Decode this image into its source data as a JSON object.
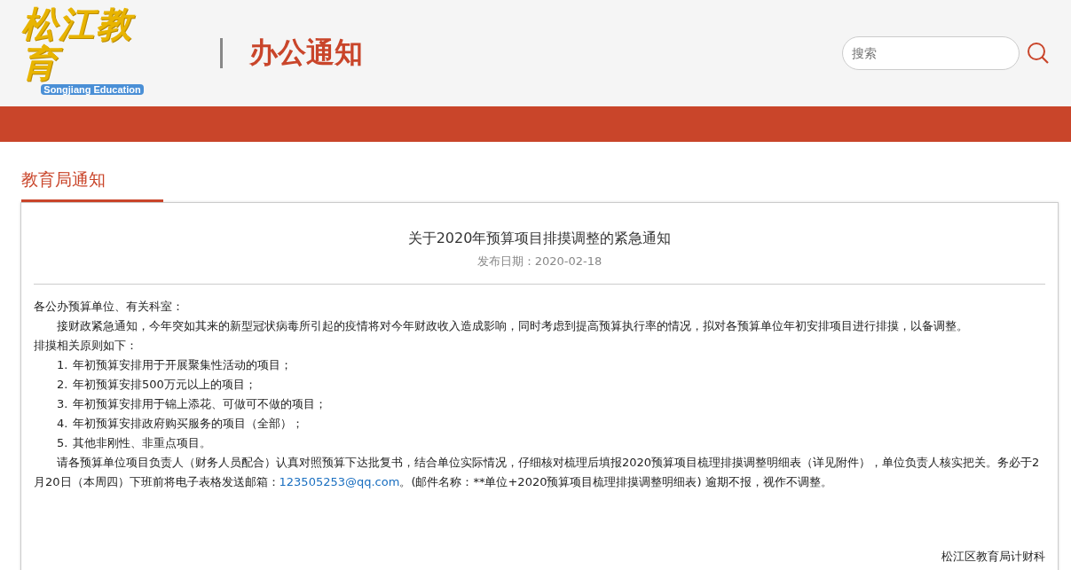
{
  "header": {
    "logo_text": "松江教育",
    "logo_subtitle": "Songjiang Education",
    "section_title": "办公通知",
    "search": {
      "placeholder": "搜索"
    }
  },
  "tabs": [
    {
      "label": "教育局通知",
      "selected": true
    }
  ],
  "article": {
    "title": "关于2020年预算项目排摸调整的紧急通知",
    "date": "发布日期：2020-02-18",
    "greeting": "各公办预算单位、有关科室：",
    "intro": "接财政紧急通知，今年突如其来的新型冠状病毒所引起的疫情将对今年财政收入造成影响，同时考虑到提高预算执行率的情况，拟对各预算单位年初安排项目进行排摸，以备调整。",
    "principles_heading": "排摸相关原则如下：",
    "items": [
      {
        "number": "1.",
        "text": "年初预算安排用于开展聚集性活动的项目；"
      },
      {
        "number": "2.",
        "text": "年初预算安排500万元以上的项目；"
      },
      {
        "number": "3.",
        "text": "年初预算安排用于锦上添花、可做可不做的项目；"
      },
      {
        "number": "4.",
        "text": "年初预算安排政府购买服务的项目（全部）；"
      },
      {
        "number": "5.",
        "text": "其他非刚性、非重点项目。"
      }
    ],
    "request_before_link": "请各预算单位项目负责人（财务人员配合）认真对照预算下达批复书，结合单位实际情况，仔细核对梳理后填报2020预算项目梳理排摸调整明细表（详见附件），单位负责人核实把关。务必于2月20日（本周四）下班前将电子表格发送邮箱：",
    "email": "123505253@qq.com",
    "request_after_link": "。(邮件名称：**单位+2020预算项目梳理排摸调整明细表) 逾期不报，视作不调整。",
    "signature": "松江区教育局计财科"
  }
}
